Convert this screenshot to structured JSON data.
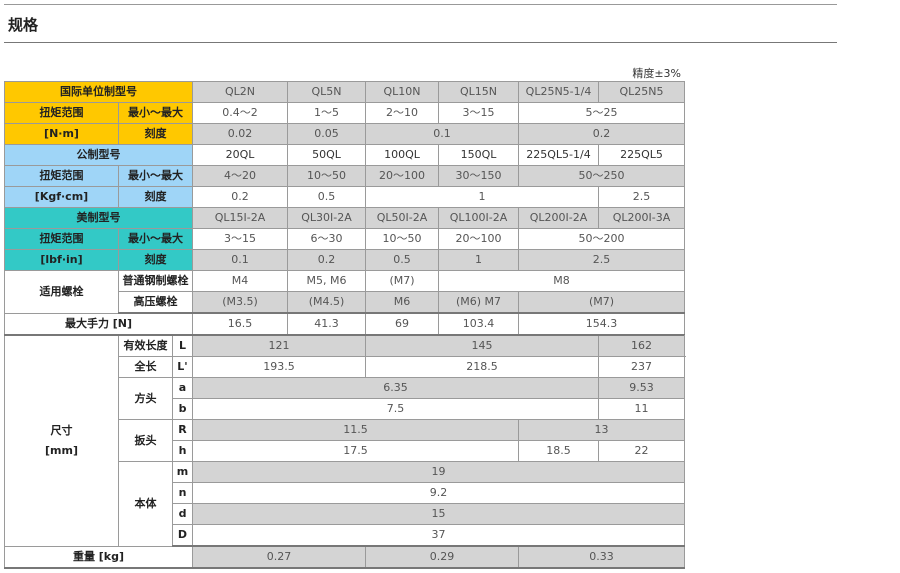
{
  "title": "规格",
  "precision": "精度±3%",
  "colors": {
    "yellow": "#ffc800",
    "blue": "#9fd5f7",
    "teal": "#33c9c6",
    "gray": "#d4d4d4"
  },
  "intl": {
    "header": "国际单位制型号",
    "models": [
      "QL2N",
      "QL5N",
      "QL10N",
      "QL15N",
      "QL25N5-1/4",
      "QL25N5"
    ],
    "range_label": "扭矩范围",
    "unit": "[N·m]",
    "minmax_label": "最小～最大",
    "minmax": [
      "0.4～2",
      "1～5",
      "2～10",
      "3～15",
      "5～25"
    ],
    "grad_label": "刻度",
    "grad": [
      "0.02",
      "0.05",
      "0.1",
      "0.2"
    ]
  },
  "metric": {
    "header": "公制型号",
    "models": [
      "20QL",
      "50QL",
      "100QL",
      "150QL",
      "225QL5-1/4",
      "225QL5"
    ],
    "range_label": "扭矩范围",
    "unit": "[Kgf·cm]",
    "minmax_label": "最小～最大",
    "minmax": [
      "4～20",
      "10～50",
      "20～100",
      "30～150",
      "50～250"
    ],
    "grad_label": "刻度",
    "grad": [
      "0.2",
      "0.5",
      "1",
      "2.5"
    ]
  },
  "us": {
    "header": "美制型号",
    "models": [
      "QL15I-2A",
      "QL30I-2A",
      "QL50I-2A",
      "QL100I-2A",
      "QL200I-2A",
      "QL200I-3A"
    ],
    "range_label": "扭矩范围",
    "unit": "[lbf·in]",
    "minmax_label": "最小～最大",
    "minmax": [
      "3～15",
      "6～30",
      "10～50",
      "20～100",
      "50～200"
    ],
    "grad_label": "刻度",
    "grad": [
      "0.1",
      "0.2",
      "0.5",
      "1",
      "2.5"
    ]
  },
  "bolt": {
    "label": "适用螺栓",
    "steel_label": "普通钢制螺栓",
    "steel": [
      "M4",
      "M5, M6",
      "(M7)",
      "M8"
    ],
    "high_label": "高压螺栓",
    "high": [
      "(M3.5)",
      "(M4.5)",
      "M6",
      "(M6) M7",
      "(M7)"
    ]
  },
  "max_force": {
    "label": "最大手力 [N]",
    "values": [
      "16.5",
      "41.3",
      "69",
      "103.4",
      "154.3"
    ]
  },
  "dims": {
    "label": "尺寸",
    "unit": "[mm]",
    "eff_label": "有效长度",
    "L": {
      "key": "L",
      "values": [
        "121",
        "145",
        "162"
      ]
    },
    "total_label": "全长",
    "Lp": {
      "key": "L'",
      "values": [
        "193.5",
        "218.5",
        "237"
      ]
    },
    "square_label": "方头",
    "a": {
      "key": "a",
      "values": [
        "6.35",
        "9.53"
      ]
    },
    "b": {
      "key": "b",
      "values": [
        "7.5",
        "11"
      ]
    },
    "wrench_label": "扳头",
    "R": {
      "key": "R",
      "values": [
        "11.5",
        "13"
      ]
    },
    "h": {
      "key": "h",
      "values": [
        "17.5",
        "18.5",
        "22"
      ]
    },
    "body_label": "本体",
    "m": {
      "key": "m",
      "values": [
        "19"
      ]
    },
    "n": {
      "key": "n",
      "values": [
        "9.2"
      ]
    },
    "d": {
      "key": "d",
      "values": [
        "15"
      ]
    },
    "D": {
      "key": "D",
      "values": [
        "37"
      ]
    }
  },
  "weight": {
    "label": "重量 [kg]",
    "values": [
      "0.27",
      "0.29",
      "0.33"
    ]
  }
}
